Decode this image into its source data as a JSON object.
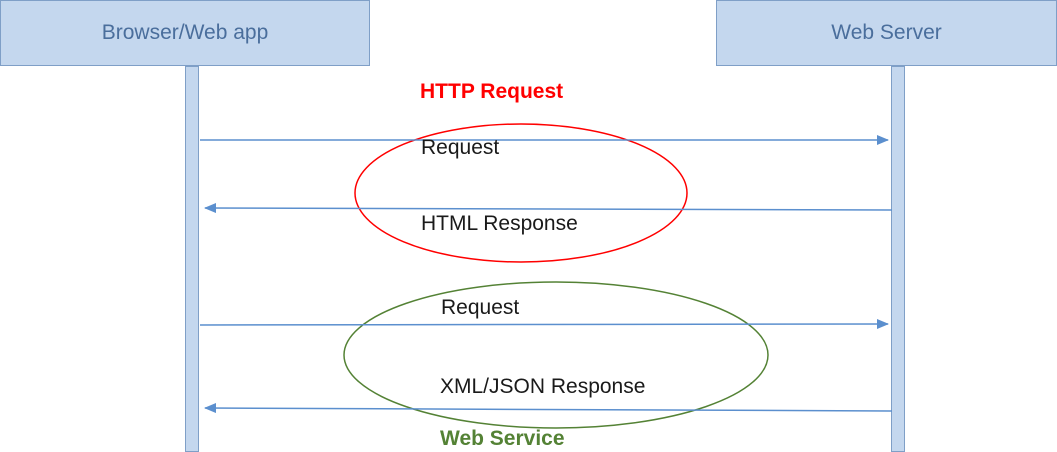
{
  "participants": {
    "left": "Browser/Web app",
    "right": "Web Server"
  },
  "groups": {
    "http": {
      "title": "HTTP Request",
      "request_label": "Request",
      "response_label": "HTML Response",
      "color": "#ff0000"
    },
    "webservice": {
      "title": "Web Service",
      "request_label": "Request",
      "response_label": "XML/JSON Response",
      "color": "#548235"
    }
  },
  "colors": {
    "box_fill": "#c4d7ee",
    "box_border": "#7f9fc7",
    "box_text": "#4a6e9c",
    "arrow": "#5b8fce"
  }
}
